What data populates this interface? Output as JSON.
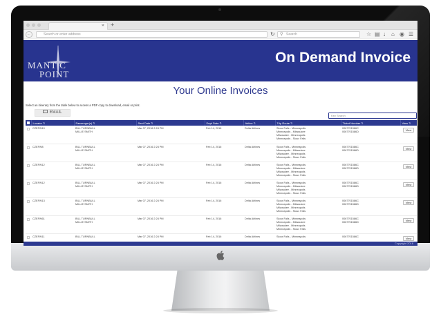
{
  "browser": {
    "address_placeholder": "Search or enter address",
    "search_placeholder": "Search",
    "tab_close": "×",
    "new_tab": "+"
  },
  "brand": {
    "logo_line1": "MANT C",
    "logo_line2": "POINT",
    "title": "On Demand Invoice",
    "header_color": "#28348f"
  },
  "page": {
    "title": "Your Online Invoices",
    "instructions": "Select an itinerary from the table below to access a PDF copy to download, email or print.",
    "email_label": "EMAIL",
    "filter_placeholder": "Key Search"
  },
  "table": {
    "headers": [
      "Locator",
      "Passenger(s)",
      "Sent Date",
      "Dept Date",
      "Airline",
      "Trip Route",
      "Ticket Number",
      "View"
    ],
    "rows": [
      {
        "locator": "CZEFW10",
        "pax1": "BILL TURNBULL",
        "pax2": "MILLIE SMITH",
        "sent": "Mar 07, 2016 2:24 PM",
        "dept": "Feb 14, 2016",
        "airline": "Delta Airlines",
        "r1": "Sioux Falls - Minneapolis",
        "r2": "Minneapolis - Milwaukee",
        "r3": "Milwaukee - Minneapolis",
        "r4": "Minneapolis - Sioux Falls",
        "t1": "0067701586C",
        "t2": "0067701586D",
        "view": "View"
      },
      {
        "locator": "CZEFW8",
        "pax1": "BILL TURNBULL",
        "pax2": "MILLIE SMITH",
        "sent": "Mar 07, 2016 2:24 PM",
        "dept": "Feb 14, 2016",
        "airline": "Delta Airlines",
        "r1": "Sioux Falls - Minneapolis",
        "r2": "Minneapolis - Milwaukee",
        "r3": "Milwaukee - Minneapolis",
        "r4": "Minneapolis - Sioux Falls",
        "t1": "0067701586C",
        "t2": "0067701586D",
        "view": "View"
      },
      {
        "locator": "CZEFW12",
        "pax1": "BILL TURNBULL",
        "pax2": "MILLIE SMITH",
        "sent": "Mar 07, 2016 2:24 PM",
        "dept": "Feb 14, 2016",
        "airline": "Delta Airlines",
        "r1": "Sioux Falls - Minneapolis",
        "r2": "Minneapolis - Milwaukee",
        "r3": "Milwaukee - Minneapolis",
        "r4": "Minneapolis - Sioux Falls",
        "t1": "0067701586C",
        "t2": "0067701586D",
        "view": "View"
      },
      {
        "locator": "CZEFW12",
        "pax1": "BILL TURNBULL",
        "pax2": "MILLIE SMITH",
        "sent": "Mar 07, 2016 2:24 PM",
        "dept": "Feb 14, 2016",
        "airline": "Delta Airlines",
        "r1": "Sioux Falls - Minneapolis",
        "r2": "Minneapolis - Milwaukee",
        "r3": "Milwaukee - Minneapolis",
        "r4": "Minneapolis - Sioux Falls",
        "t1": "0067701586C",
        "t2": "0067701586D",
        "view": "View"
      },
      {
        "locator": "CZEFW13",
        "pax1": "BILL TURNBULL",
        "pax2": "MILLIE SMITH",
        "sent": "Mar 07, 2016 2:24 PM",
        "dept": "Feb 14, 2016",
        "airline": "Delta Airlines",
        "r1": "Sioux Falls - Minneapolis",
        "r2": "Minneapolis - Milwaukee",
        "r3": "Milwaukee - Minneapolis",
        "r4": "Minneapolis - Sioux Falls",
        "t1": "0067701586C",
        "t2": "0067701586D",
        "view": "View"
      },
      {
        "locator": "CZEFW61",
        "pax1": "BILL TURNBULL",
        "pax2": "MILLIE SMITH",
        "sent": "Mar 07, 2016 2:24 PM",
        "dept": "Feb 14, 2016",
        "airline": "Delta Airlines",
        "r1": "Sioux Falls - Minneapolis",
        "r2": "Minneapolis - Milwaukee",
        "r3": "Milwaukee - Minneapolis",
        "r4": "Minneapolis - Sioux Falls",
        "t1": "0067701586C",
        "t2": "0067701586D",
        "view": "View"
      },
      {
        "locator": "CZEFW11",
        "pax1": "BILL TURNBULL",
        "pax2": "",
        "sent": "Mar 07, 2016 2:24 PM",
        "dept": "Feb 14, 2016",
        "airline": "Delta Airlines",
        "r1": "Sioux Falls - Minneapolis",
        "r2": "",
        "r3": "",
        "r4": "",
        "t1": "0067701586C",
        "t2": "",
        "view": "View"
      }
    ]
  },
  "footer": {
    "copyright": "Copyright 2016"
  }
}
